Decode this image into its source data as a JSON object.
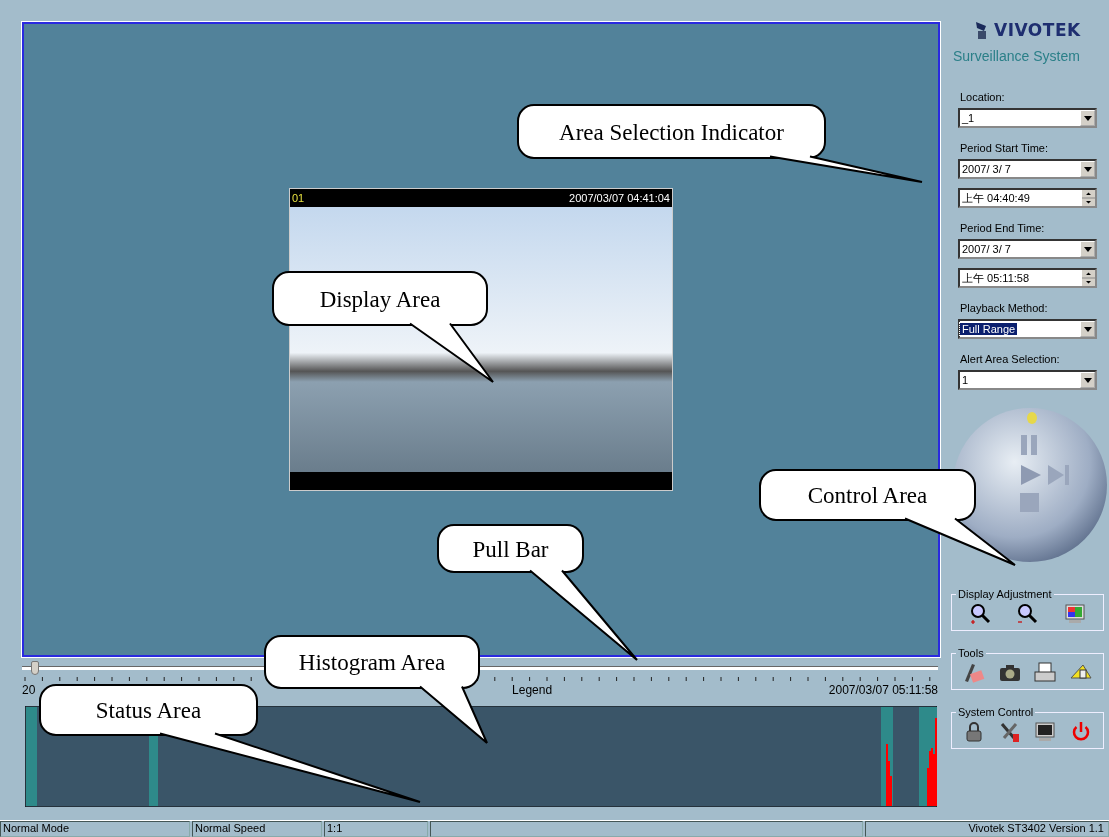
{
  "display": {
    "channel": "01",
    "timestamp": "2007/03/07 04:41:04"
  },
  "timeline": {
    "level": 0.01,
    "start_label": "20",
    "legend": "Legend",
    "end_label": "2007/03/07 05:11:58"
  },
  "panel": {
    "brand": "VIVOTEK",
    "product": "Surveillance System",
    "fields": [
      {
        "label": "Location:",
        "kind": "dropdown",
        "value": "_1",
        "highlighted": false
      },
      {
        "label": "Period Start Time:",
        "kind": "dropdown",
        "value": "2007/  3/  7",
        "highlighted": false
      },
      {
        "kind": "spinner",
        "value": "上午 04:40:49",
        "highlighted": false
      },
      {
        "label": "Period End Time:",
        "kind": "dropdown",
        "value": "2007/  3/  7",
        "highlighted": false
      },
      {
        "kind": "spinner",
        "value": "上午 05:11:58",
        "highlighted": false
      },
      {
        "label": "Playback Method:",
        "kind": "dropdown",
        "value": "Full Range",
        "highlighted": true
      },
      {
        "label": "Alert Area Selection:",
        "kind": "dropdown",
        "value": "1",
        "highlighted": false
      }
    ]
  },
  "groups": [
    {
      "title": "Display Adjustment"
    },
    {
      "title": "Tools"
    },
    {
      "title": "System Control"
    }
  ],
  "status_bar": {
    "mode": "Normal Mode",
    "speed": "Normal Speed",
    "ratio": "1:1",
    "version": "Vivotek ST3402   Version 1.1"
  },
  "callouts": [
    {
      "label": "Area Selection Indicator"
    },
    {
      "label": "Display Area"
    },
    {
      "label": "Control Area"
    },
    {
      "label": "Pull Bar"
    },
    {
      "label": "Histogram Area"
    },
    {
      "label": "Status Area"
    }
  ]
}
